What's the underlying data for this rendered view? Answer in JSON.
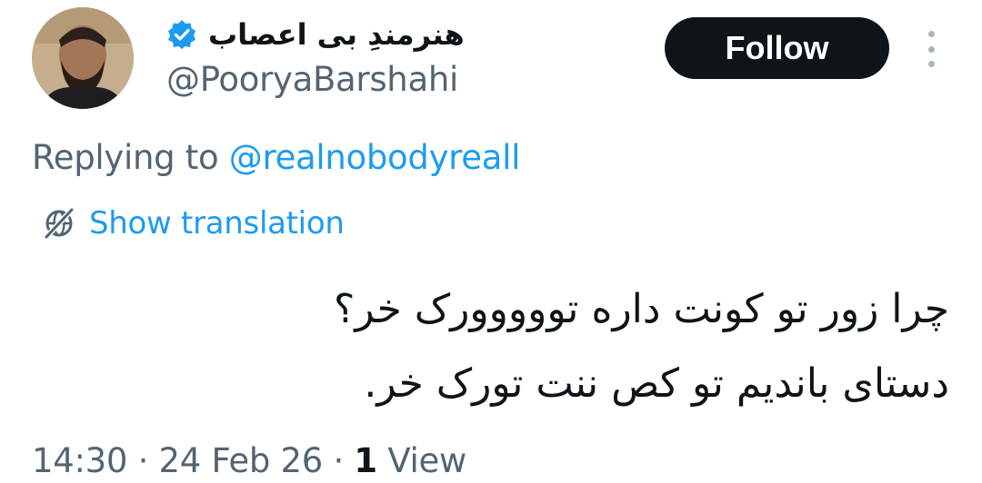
{
  "user": {
    "display_name": "هنرمندِ بی اعصاب",
    "handle": "@PooryaBarshahi",
    "verified_icon": "verified-badge-icon",
    "avatar_icon": "profile-photo"
  },
  "actions": {
    "follow_label": "Follow",
    "more_icon": "more-vertical-icon"
  },
  "reply": {
    "prefix": "Replying to ",
    "mention": "@realnobodyreall"
  },
  "translation": {
    "label": "Show translation",
    "icon": "translate-globe-icon"
  },
  "tweet": {
    "lines": [
      "چرا زور تو کونت داره تووووورک خر؟",
      "دستای باندیم تو کص ننت تورک خر."
    ]
  },
  "meta": {
    "time": "14:30",
    "separator": " · ",
    "date": "24 Feb 26",
    "views_count": "1",
    "views_label": " View"
  },
  "colors": {
    "text_primary": "#0f1419",
    "text_secondary": "#536471",
    "link": "#1d9bf0",
    "follow_bg": "#0f1419"
  }
}
